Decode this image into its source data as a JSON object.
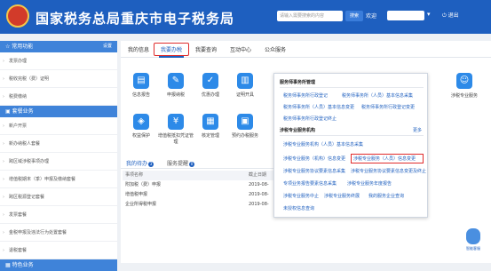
{
  "header": {
    "title": "国家税务总局重庆市电子税务局",
    "search_placeholder": "请输入需要搜索的内容",
    "search_button": "搜索",
    "welcome": "欢迎",
    "logout": "退出",
    "colors": {
      "header_bg": "#1e5fbf",
      "logo_red": "#d23b2a"
    }
  },
  "sidebar": {
    "section1": {
      "title": "常用功能",
      "settings": "设置"
    },
    "items1": [
      "发票办理",
      "税收完税（费）证明",
      "税费缴纳"
    ],
    "section2": {
      "title": "套餐业务"
    },
    "items2": [
      "新户开票",
      "新办纳税人套餐",
      "跨区域涉税事项办理",
      "增值税期末（季）申报及缴纳套餐",
      "跨区税源登记套餐",
      "发票套餐",
      "金税申报及违法行为处置套餐",
      "退税套餐"
    ],
    "section3": {
      "title": "特色业务"
    }
  },
  "tabs": [
    "我的信息",
    "我要办税",
    "我要查询",
    "互动中心",
    "公众服务"
  ],
  "icons": {
    "row1": [
      "信息报告",
      "申报纳税",
      "优惠办理",
      "证明开具"
    ],
    "row2": [
      "权益保护",
      "增值税抵扣凭证管理",
      "核定管理",
      "预约办税服务"
    ],
    "side": "涉税专业服务"
  },
  "dropdown": {
    "section1_title": "服务师事务所管理",
    "links1": [
      "税务师事务所行政登记",
      "税务师事务所（人员）基本信息采集",
      "税务师事务所（人员）基本信息变更",
      "税务师事务所行政登记变更",
      "税务师事务所行政登记终止"
    ],
    "section2_title": "涉税专业服务机构",
    "more": "更多",
    "links2": [
      "涉税专业服务机构（人员）基本信息采集",
      "涉税专业服务（机构）信息变更",
      "涉税专业服务（人员）信息变更",
      "涉税专业服务协议要素信息采集",
      "涉税专业服务协议要素信息变更及终止",
      "专项业务报告要素信息采集",
      "涉税专业服务年度报告",
      "涉税专业服务中止",
      "涉税专业服务终展",
      "我的服务企业查询",
      "未授权信息查询"
    ]
  },
  "todo": {
    "tab1": "我的待办",
    "badge1": "3",
    "tab2": "服务提醒",
    "badge2": "0",
    "head": [
      "事项名称",
      "截止日期"
    ],
    "rows": [
      [
        "附加税（费）申报",
        "2019-08-"
      ],
      [
        "增值税申报",
        "2019-08-"
      ],
      [
        "企业所得税申报",
        "2019-08-"
      ]
    ]
  },
  "assistant": "智能客服"
}
